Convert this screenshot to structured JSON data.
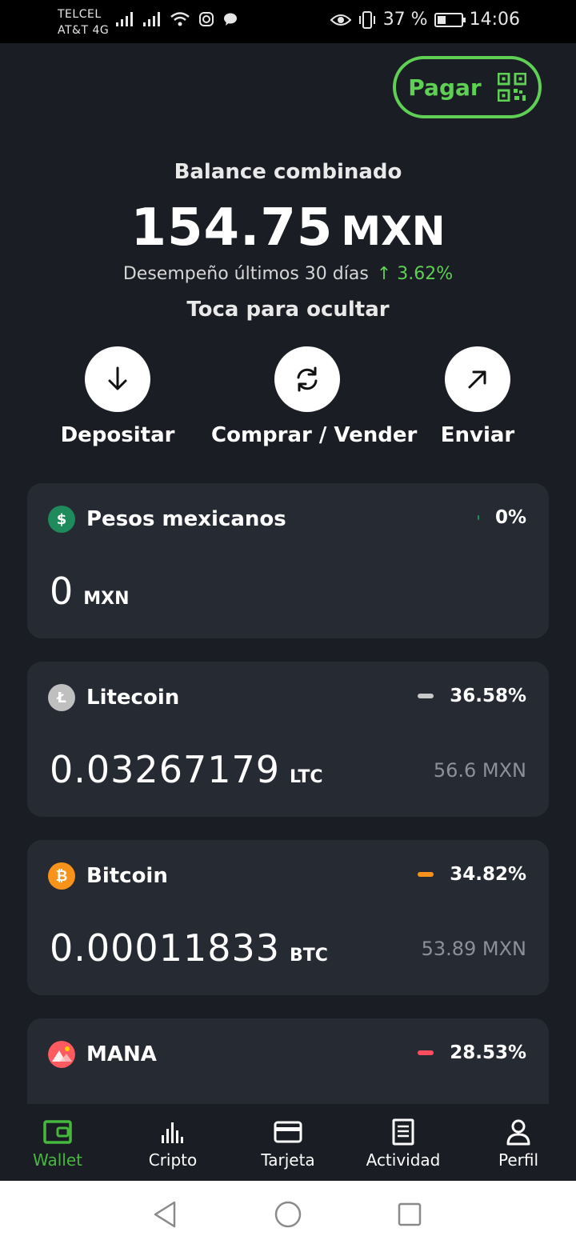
{
  "status_bar": {
    "carrier_line1": "TELCEL",
    "carrier_line2": "AT&T 4G",
    "battery_percent": "37 %",
    "battery_level": 0.37,
    "time": "14:06"
  },
  "header": {
    "pay_label": "Pagar"
  },
  "balance": {
    "label": "Balance combinado",
    "amount": "154.75",
    "currency": "MXN",
    "performance_label": "Desempeño últimos 30 días",
    "performance_value": "↑ 3.62%",
    "hide_hint": "Toca para ocultar"
  },
  "actions": [
    {
      "label": "Depositar",
      "icon": "arrow-down-icon"
    },
    {
      "label": "Comprar / Vender",
      "icon": "refresh-icon"
    },
    {
      "label": "Enviar",
      "icon": "arrow-up-right-icon"
    }
  ],
  "assets": [
    {
      "name": "Pesos mexicanos",
      "symbol_glyph": "$",
      "coin_color": "#1f8a5b",
      "share": "0%",
      "share_color": "#1f8a5b",
      "amount": "0",
      "unit": "MXN",
      "fiat": ""
    },
    {
      "name": "Litecoin",
      "symbol_glyph": "Ł",
      "coin_color": "#bfbfbf",
      "share": "36.58%",
      "share_color": "#c8c8c8",
      "amount": "0.03267179",
      "unit": "LTC",
      "fiat": "56.6 MXN"
    },
    {
      "name": "Bitcoin",
      "symbol_glyph": "₿",
      "coin_color": "#f7931a",
      "share": "34.82%",
      "share_color": "#f7931a",
      "amount": "0.00011833",
      "unit": "BTC",
      "fiat": "53.89 MXN"
    },
    {
      "name": "MANA",
      "symbol_glyph": "",
      "coin_color": "#ff5a5f",
      "share": "28.53%",
      "share_color": "#ff4d5e",
      "amount": "",
      "unit": "",
      "fiat": ""
    }
  ],
  "bottom_nav": [
    {
      "label": "Wallet",
      "icon": "wallet-icon",
      "active": true
    },
    {
      "label": "Cripto",
      "icon": "chart-bars-icon",
      "active": false
    },
    {
      "label": "Tarjeta",
      "icon": "card-icon",
      "active": false
    },
    {
      "label": "Actividad",
      "icon": "document-icon",
      "active": false
    },
    {
      "label": "Perfil",
      "icon": "person-icon",
      "active": false
    }
  ],
  "colors": {
    "background": "#1a1d23",
    "card": "#262a33",
    "accent_green": "#5fcf55",
    "nav_active": "#46b83e"
  }
}
